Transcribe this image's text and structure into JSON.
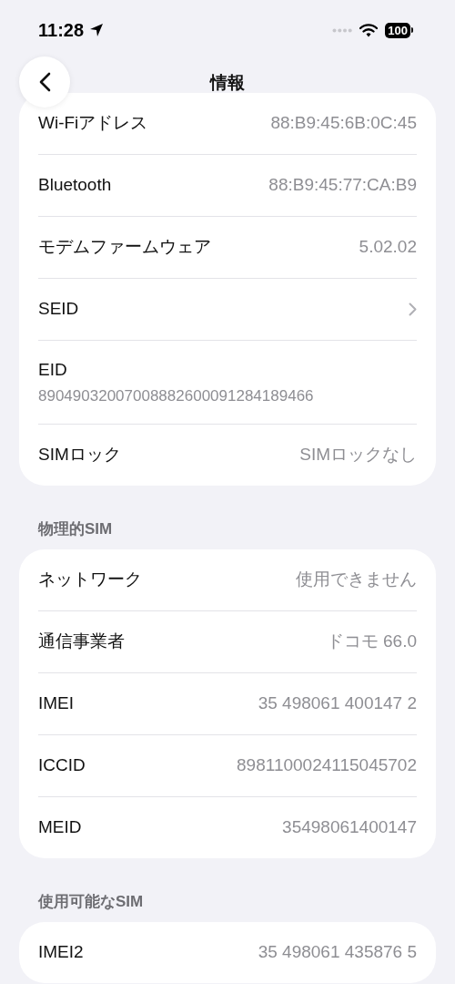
{
  "status_bar": {
    "time": "11:28",
    "battery": "100"
  },
  "nav": {
    "title": "情報"
  },
  "sections": [
    {
      "rows": [
        {
          "kind": "value",
          "label": "Wi-Fiアドレス",
          "value": "88:B9:45:6B:0C:45"
        },
        {
          "kind": "value",
          "label": "Bluetooth",
          "value": "88:B9:45:77:CA:B9"
        },
        {
          "kind": "value",
          "label": "モデムファームウェア",
          "value": "5.02.02"
        },
        {
          "kind": "link",
          "label": "SEID"
        },
        {
          "kind": "stacked",
          "label": "EID",
          "value": "89049032007008882600091284189466"
        },
        {
          "kind": "value",
          "label": "SIMロック",
          "value": "SIMロックなし"
        }
      ]
    },
    {
      "header": "物理的SIM",
      "rows": [
        {
          "kind": "value",
          "label": "ネットワーク",
          "value": "使用できません"
        },
        {
          "kind": "value",
          "label": "通信事業者",
          "value": "ドコモ 66.0"
        },
        {
          "kind": "value",
          "label": "IMEI",
          "value": "35 498061 400147 2"
        },
        {
          "kind": "value",
          "label": "ICCID",
          "value": "8981100024115045702"
        },
        {
          "kind": "value",
          "label": "MEID",
          "value": "35498061400147"
        }
      ]
    },
    {
      "header": "使用可能なSIM",
      "rows": [
        {
          "kind": "value",
          "label": "IMEI2",
          "value": "35 498061 435876 5"
        }
      ]
    }
  ]
}
